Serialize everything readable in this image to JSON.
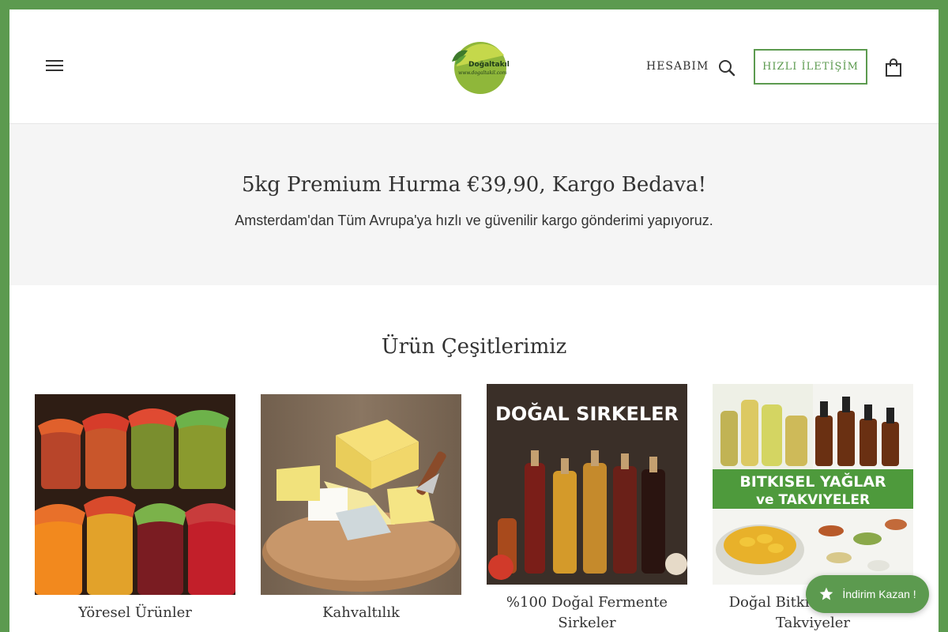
{
  "header": {
    "logo_text": "Doğaltakıl",
    "logo_url_text": "www.dogaltakil.com",
    "account_label": "HESABIM",
    "contact_button_label": "HIZLI İLETİŞİM"
  },
  "promo": {
    "title": "5kg Premium Hurma €39,90, Kargo Bedava!",
    "subtitle": "Amsterdam'dan Tüm Avrupa'ya hızlı ve güvenilir kargo gönderimi yapıyoruz."
  },
  "products": {
    "section_title": "Ürün Çeşitlerimiz",
    "items": [
      {
        "label": "Yöresel Ürünler"
      },
      {
        "label": "Kahvaltılık"
      },
      {
        "label": "%100 Doğal Fermente Sirkeler",
        "image_text": "DOĞAL SIRKELER"
      },
      {
        "label": "Doğal Bitkisel Yağlar & Takviyeler",
        "image_text_line1": "BITKISEL YAĞLAR",
        "image_text_line2": "ve TAKVIYELER"
      }
    ]
  },
  "reward": {
    "label": "İndirim Kazan !"
  },
  "colors": {
    "brand_green": "#5c9a4f",
    "promo_bg": "#f5f5f5",
    "text": "#333333"
  }
}
